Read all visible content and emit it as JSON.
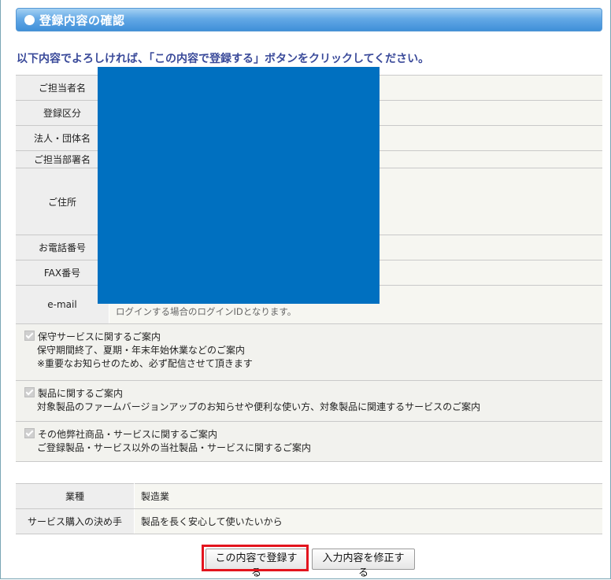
{
  "section": {
    "title": "登録内容の確認"
  },
  "instruction": "以下内容でよろしければ、「この内容で登録する」ボタンをクリックしてください。",
  "fields": [
    {
      "label": "ご担当者名",
      "value": ""
    },
    {
      "label": "登録区分",
      "value": ""
    },
    {
      "label": "法人・団体名",
      "value": ""
    },
    {
      "label": "ご担当部署名",
      "value": ""
    },
    {
      "label": "ご住所",
      "value": ""
    },
    {
      "label": "お電話番号",
      "value": ""
    },
    {
      "label": "FAX番号",
      "value": ""
    },
    {
      "label": "e-mail",
      "value": "",
      "note": "ログインする場合のログインIDとなります。"
    }
  ],
  "consents": [
    {
      "title": "保守サービスに関するご案内",
      "desc": "保守期間終了、夏期・年末年始休業などのご案内",
      "desc2": "※重要なお知らせのため、必ず配信させて頂きます"
    },
    {
      "title": "製品に関するご案内",
      "desc": "対象製品のファームバージョンアップのお知らせや便利な使い方、対象製品に関連するサービスのご案内"
    },
    {
      "title": "その他弊社商品・サービスに関するご案内",
      "desc": "ご登録製品・サービス以外の当社製品・サービスに関するご案内"
    }
  ],
  "extra": [
    {
      "label": "業種",
      "value": "製造業"
    },
    {
      "label": "サービス購入の決め手",
      "value": "製品を長く安心して使いたいから"
    }
  ],
  "buttons": {
    "confirm": "この内容で登録する",
    "edit": "入力内容を修正する"
  },
  "colors": {
    "accent": "#3f8fd8",
    "redaction": "#0070c0",
    "highlight": "#e3141e"
  }
}
